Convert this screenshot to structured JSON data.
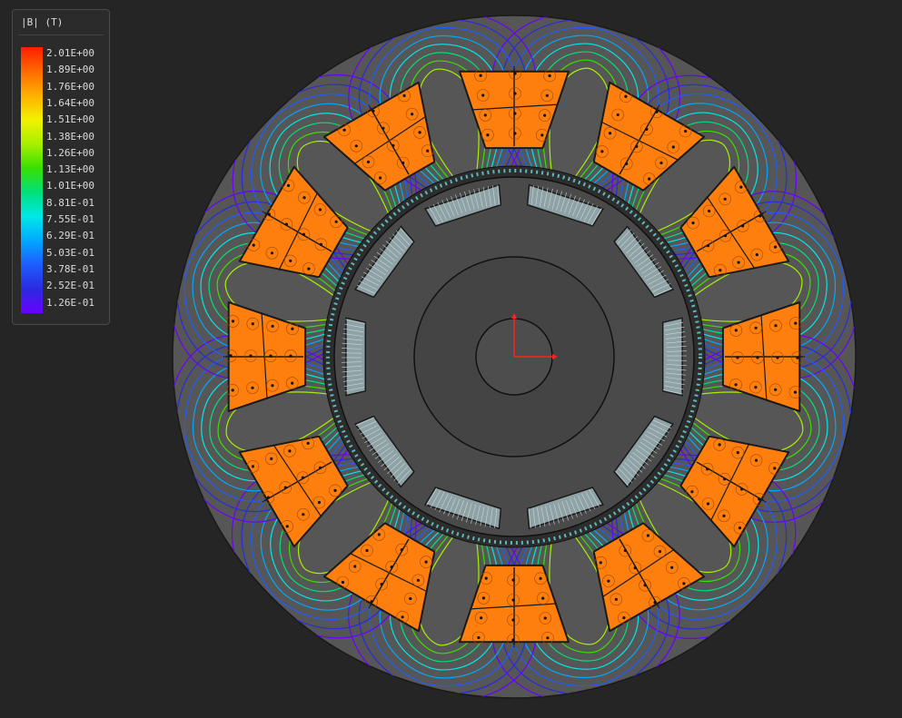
{
  "legend": {
    "title": "|B| (T)",
    "labels": [
      "2.01E+00",
      "1.89E+00",
      "1.76E+00",
      "1.64E+00",
      "1.51E+00",
      "1.38E+00",
      "1.26E+00",
      "1.13E+00",
      "1.01E+00",
      "8.81E-01",
      "7.55E-01",
      "6.29E-01",
      "5.03E-01",
      "3.78E-01",
      "2.52E-01",
      "1.26E-01"
    ],
    "colormap": [
      "#ff1e00",
      "#ff6a00",
      "#ffb000",
      "#f2f200",
      "#a8f000",
      "#38e000",
      "#00e07a",
      "#00e8e8",
      "#00a8ff",
      "#1e5cff",
      "#2a2ae0",
      "#6a00ff"
    ]
  },
  "colors": {
    "background": "#252526",
    "stator_core": "#565656",
    "rotor_core": "#4a4a4a",
    "shaft": "#444444",
    "winding": "#ff7f0e",
    "magnet": "#8fa3a6",
    "axis_x": "#ff2020",
    "axis_y": "#ff2020"
  },
  "motor": {
    "stator_slots": 12,
    "rotor_poles": 10
  }
}
